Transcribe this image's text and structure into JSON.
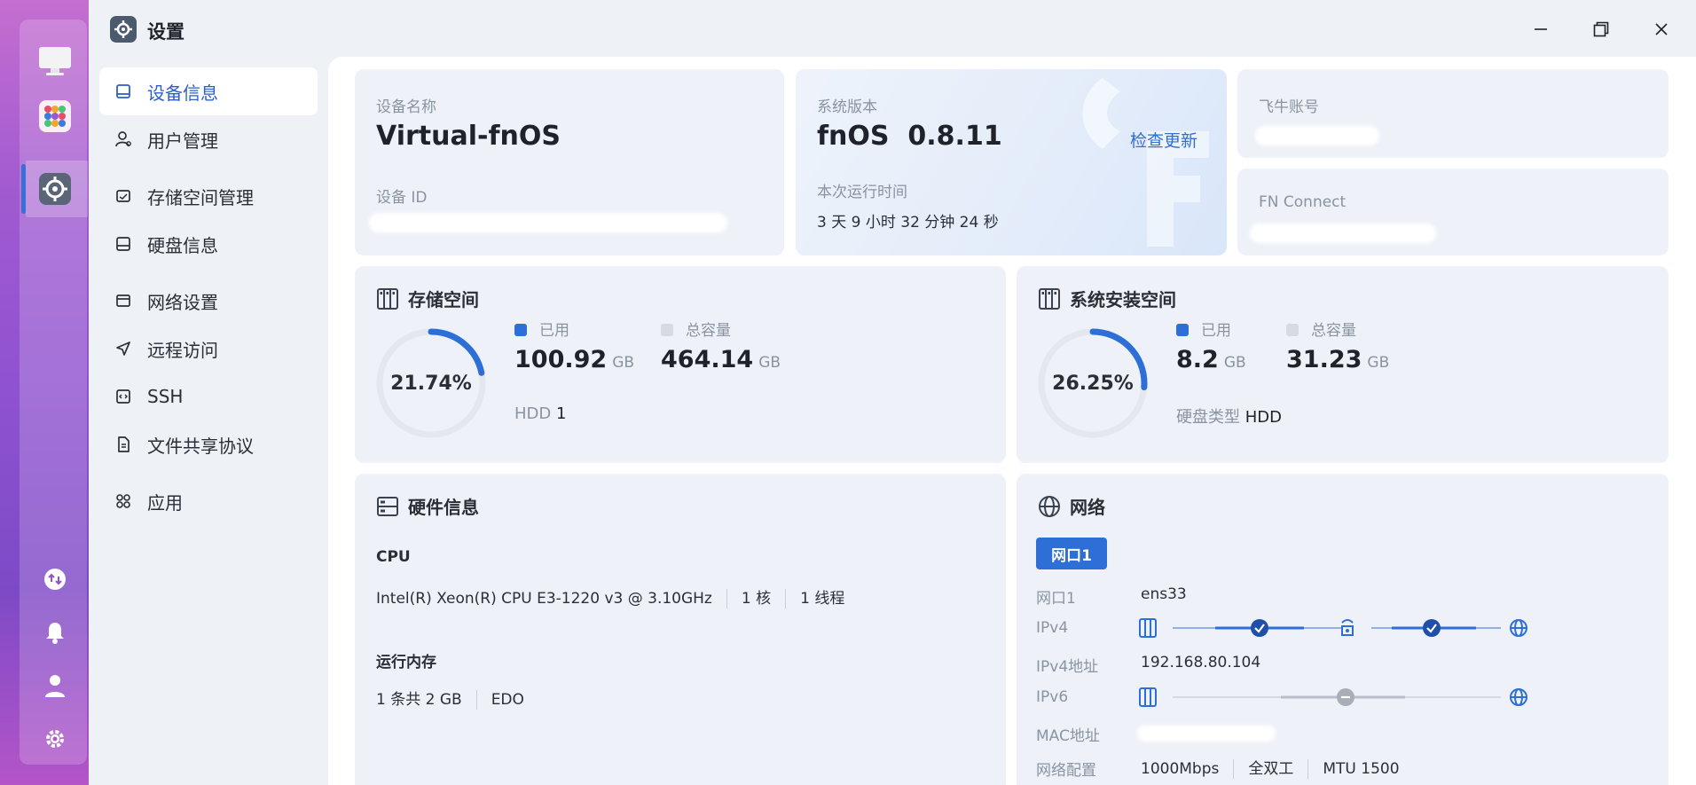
{
  "app": {
    "title": "设置"
  },
  "sidebar": {
    "items": [
      {
        "label": "设备信息",
        "icon": "device-icon"
      },
      {
        "label": "用户管理",
        "icon": "user-icon"
      },
      {
        "label": "存储空间管理",
        "icon": "storage-icon"
      },
      {
        "label": "硬盘信息",
        "icon": "disk-icon"
      },
      {
        "label": "网络设置",
        "icon": "network-icon"
      },
      {
        "label": "远程访问",
        "icon": "send-icon"
      },
      {
        "label": "SSH",
        "icon": "code-icon"
      },
      {
        "label": "文件共享协议",
        "icon": "file-icon"
      },
      {
        "label": "应用",
        "icon": "apps-icon"
      }
    ]
  },
  "device": {
    "name_label": "设备名称",
    "name": "Virtual-fnOS",
    "id_label": "设备 ID"
  },
  "system": {
    "version_label": "系统版本",
    "version": "fnOS  0.8.11",
    "check_update": "检查更新",
    "uptime_label": "本次运行时间",
    "uptime": "3 天 9 小时 32 分钟 24 秒"
  },
  "account": {
    "label": "飞牛账号"
  },
  "fn_connect": {
    "label": "FN Connect"
  },
  "storage": {
    "title": "存储空间",
    "percent": "21.74%",
    "fraction": 0.2174,
    "used_label": "已用",
    "used": "100.92",
    "used_unit": "GB",
    "total_label": "总容量",
    "total": "464.14",
    "total_unit": "GB",
    "hdd_label": "HDD",
    "hdd_count": "1"
  },
  "sys_storage": {
    "title": "系统安装空间",
    "percent": "26.25%",
    "fraction": 0.2625,
    "used_label": "已用",
    "used": "8.2",
    "used_unit": "GB",
    "total_label": "总容量",
    "total": "31.23",
    "total_unit": "GB",
    "disk_type_label": "硬盘类型",
    "disk_type": "HDD"
  },
  "hardware": {
    "title": "硬件信息",
    "cpu_label": "CPU",
    "cpu_model": "Intel(R) Xeon(R) CPU E3-1220 v3 @ 3.10GHz",
    "cpu_cores": "1 核",
    "cpu_threads": "1 线程",
    "mem_label": "运行内存",
    "mem_size": "1 条共 2 GB",
    "mem_type": "EDO"
  },
  "network": {
    "title": "网络",
    "tab": "网口1",
    "port_label": "网口1",
    "port": "ens33",
    "ipv4_label": "IPv4",
    "ipv4_addr_label": "IPv4地址",
    "ipv4_addr": "192.168.80.104",
    "ipv6_label": "IPv6",
    "mac_label": "MAC地址",
    "config_label": "网络配置",
    "speed": "1000Mbps",
    "duplex": "全双工",
    "mtu": "MTU 1500"
  },
  "colors": {
    "accent": "#2d6fd6",
    "ring_bg": "#e3e7ee",
    "legend_total": "#d6dae1"
  }
}
